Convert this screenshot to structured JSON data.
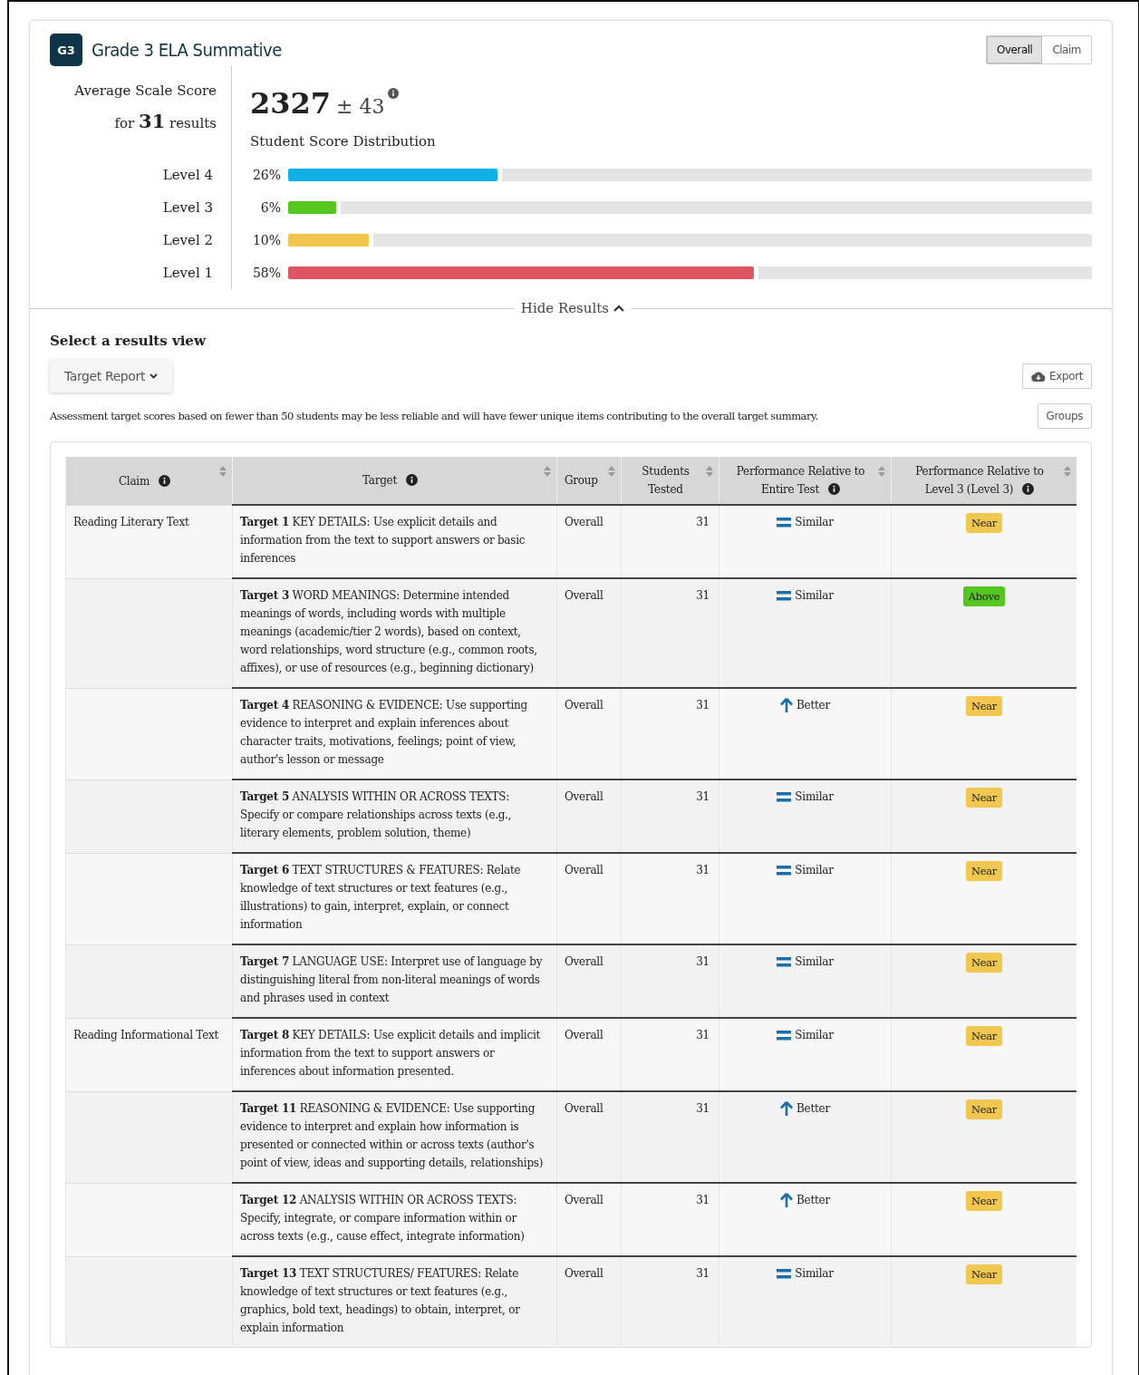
{
  "header": {
    "badge": "G3",
    "title": "Grade 3 ELA Summative",
    "view_toggle": [
      {
        "label": "Overall",
        "selected": true
      },
      {
        "label": "Claim",
        "selected": false
      }
    ]
  },
  "summary": {
    "label": "Average Scale Score",
    "results_prefix": "for",
    "results_count": "31",
    "results_suffix": "results",
    "score": "2327",
    "error": "± 43",
    "distribution_title": "Student Score Distribution",
    "levels": [
      {
        "name": "Level 4",
        "percent": "26%",
        "level": 0.26,
        "color": "#0eb0e6"
      },
      {
        "name": "Level 3",
        "percent": "6%",
        "level": 0.06,
        "color": "#55c61f"
      },
      {
        "name": "Level 2",
        "percent": "10%",
        "level": 0.1,
        "color": "#f1c750"
      },
      {
        "name": "Level 1",
        "percent": "58%",
        "level": 0.58,
        "color": "#df5461"
      }
    ]
  },
  "hide_results": "Hide Results",
  "results_view": {
    "title": "Select a results view",
    "dropdown": "Target Report",
    "export": "Export",
    "note": "Assessment target scores based on fewer than 50 students may be less reliable and will have fewer unique items contributing to the overall target summary.",
    "groups": "Groups"
  },
  "table": {
    "columns": [
      {
        "label": "Claim",
        "info": true
      },
      {
        "label": "Target",
        "info": true
      },
      {
        "label": "Group",
        "info": false
      },
      {
        "label": "Students Tested",
        "info": false
      },
      {
        "label": "Performance Relative to Entire Test",
        "info": true
      },
      {
        "label": "Performance Relative to Level 3 (Level 3)",
        "info": true
      }
    ],
    "rows": [
      {
        "claim": "Reading Literary Text",
        "target": "**Target 1** KEY DETAILS: Use explicit details and information from the text to support answers or basic inferences",
        "group": "Overall",
        "students": "31",
        "performance": {
          "kind": "similar",
          "label": "Similar"
        },
        "level3": {
          "label": "Near",
          "color": "#f1c750"
        }
      },
      {
        "target": "**Target 3** WORD MEANINGS: Determine intended meanings of words, including words with multiple meanings (academic/tier 2 words), based on context, word relationships, word structure (e.g., common roots, affixes), or use of resources (e.g., beginning dictionary)",
        "group": "Overall",
        "students": "31",
        "performance": {
          "kind": "similar",
          "label": "Similar"
        },
        "level3": {
          "label": "Above",
          "color": "#55c61f"
        }
      },
      {
        "target": "**Target 4** REASONING & EVIDENCE: Use supporting evidence to interpret and explain inferences about character traits, motivations, feelings; point of view, author's lesson or message",
        "group": "Overall",
        "students": "31",
        "performance": {
          "kind": "better",
          "label": "Better"
        },
        "level3": {
          "label": "Near",
          "color": "#f1c750"
        }
      },
      {
        "target": "**Target 5** ANALYSIS WITHIN OR ACROSS TEXTS: Specify or compare relationships across texts (e.g., literary elements, problem solution, theme)",
        "group": "Overall",
        "students": "31",
        "performance": {
          "kind": "similar",
          "label": "Similar"
        },
        "level3": {
          "label": "Near",
          "color": "#f1c750"
        }
      },
      {
        "target": "**Target 6** TEXT STRUCTURES & FEATURES: Relate knowledge of text structures or text features (e.g., illustrations) to gain, interpret, explain, or connect information",
        "group": "Overall",
        "students": "31",
        "performance": {
          "kind": "similar",
          "label": "Similar"
        },
        "level3": {
          "label": "Near",
          "color": "#f1c750"
        }
      },
      {
        "target": "**Target 7** LANGUAGE USE: Interpret use of language by distinguishing literal from non-literal meanings of words and phrases used in context",
        "group": "Overall",
        "students": "31",
        "performance": {
          "kind": "similar",
          "label": "Similar"
        },
        "level3": {
          "label": "Near",
          "color": "#f1c750"
        }
      },
      {
        "claim": "Reading Informational Text",
        "target": "**Target 8** KEY DETAILS: Use explicit details and implicit information from the text to support answers or inferences about information presented.",
        "group": "Overall",
        "students": "31",
        "performance": {
          "kind": "similar",
          "label": "Similar"
        },
        "level3": {
          "label": "Near",
          "color": "#f1c750"
        }
      },
      {
        "target": "**Target 11** REASONING & EVIDENCE: Use supporting evidence to interpret and explain how information is presented or connected within or across texts (author's point of view, ideas and supporting details, relationships)",
        "group": "Overall",
        "students": "31",
        "performance": {
          "kind": "better",
          "label": "Better"
        },
        "level3": {
          "label": "Near",
          "color": "#f1c750"
        }
      },
      {
        "target": "**Target 12** ANALYSIS WITHIN OR ACROSS TEXTS: Specify, integrate, or compare information within or across texts (e.g., cause effect, integrate information)",
        "group": "Overall",
        "students": "31",
        "performance": {
          "kind": "better",
          "label": "Better"
        },
        "level3": {
          "label": "Near",
          "color": "#f1c750"
        }
      },
      {
        "target": "**Target 13** TEXT STRUCTURES/ FEATURES: Relate knowledge of text structures or text features (e.g., graphics, bold text, headings) to obtain, interpret, or explain information",
        "group": "Overall",
        "students": "31",
        "performance": {
          "kind": "similar",
          "label": "Similar"
        },
        "level3": {
          "label": "Near",
          "color": "#f1c750"
        }
      }
    ]
  }
}
